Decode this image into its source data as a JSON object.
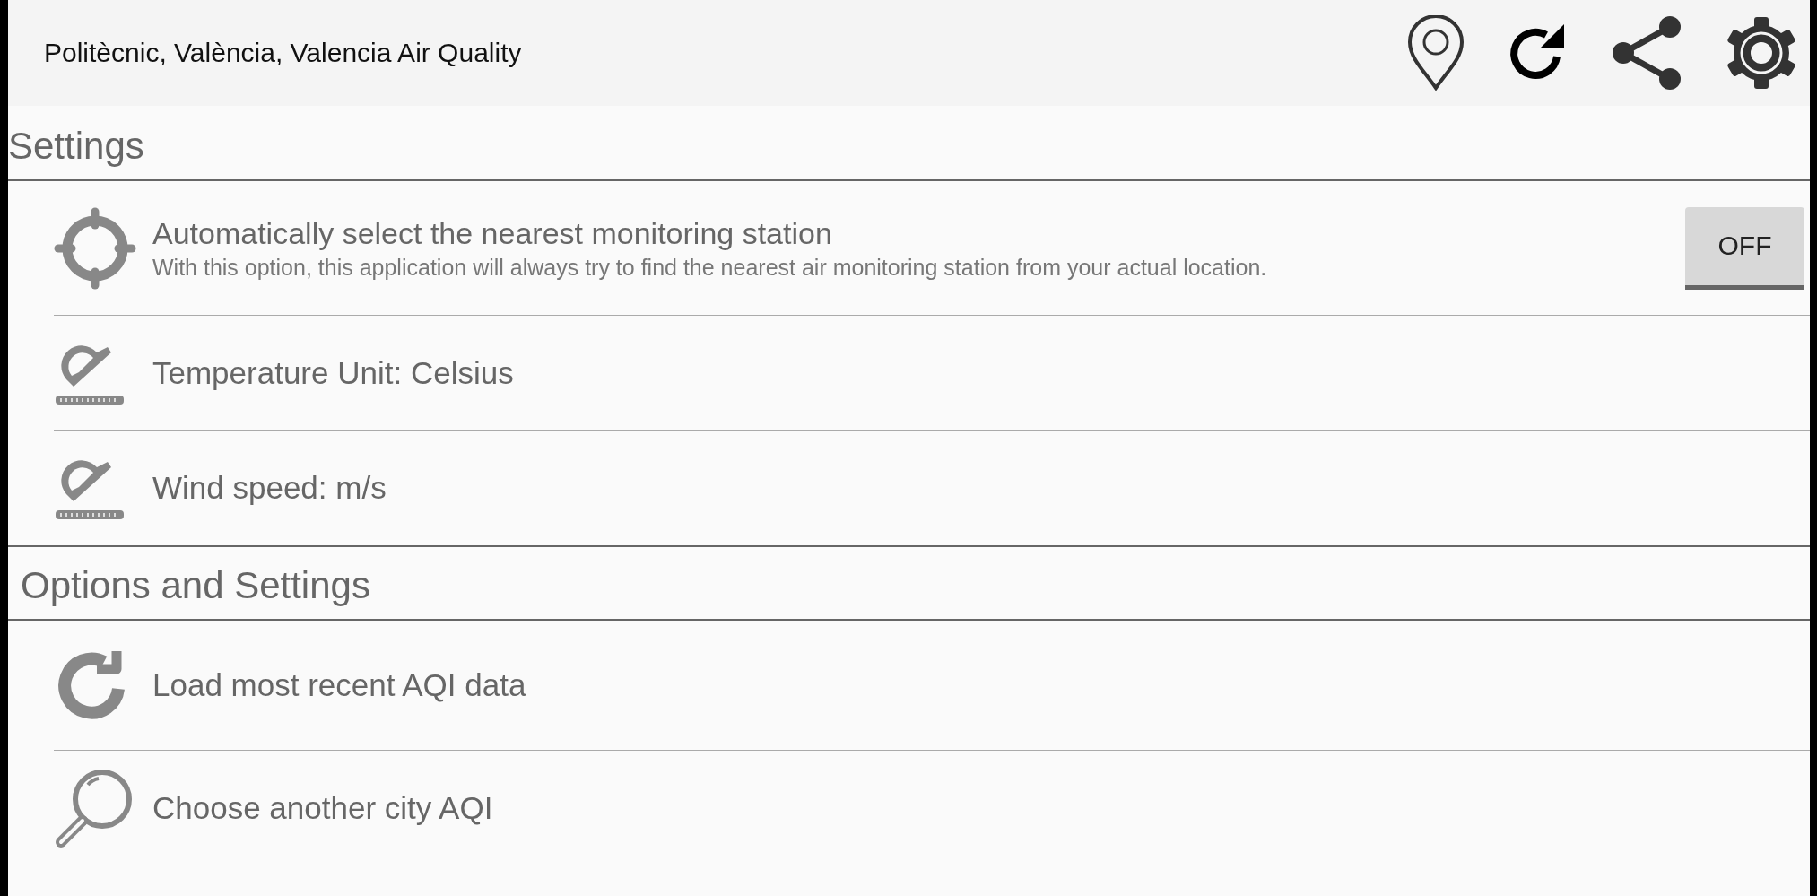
{
  "header": {
    "title": "Politècnic, València, Valencia Air Quality"
  },
  "sections": [
    {
      "title": "Settings",
      "items": [
        {
          "kind": "toggle",
          "label": "Automatically select the nearest monitoring station",
          "description": "With this option, this application will always try to find the nearest air monitoring station from your actual location.",
          "toggle": {
            "label": "OFF",
            "on": false
          }
        },
        {
          "kind": "setting",
          "label": "Temperature Unit: Celsius"
        },
        {
          "kind": "setting",
          "label": "Wind speed: m/s"
        }
      ]
    },
    {
      "title": "Options and Settings",
      "items": [
        {
          "kind": "action",
          "label": "Load most recent AQI data"
        },
        {
          "kind": "action",
          "label": "Choose another city AQI"
        }
      ]
    }
  ]
}
